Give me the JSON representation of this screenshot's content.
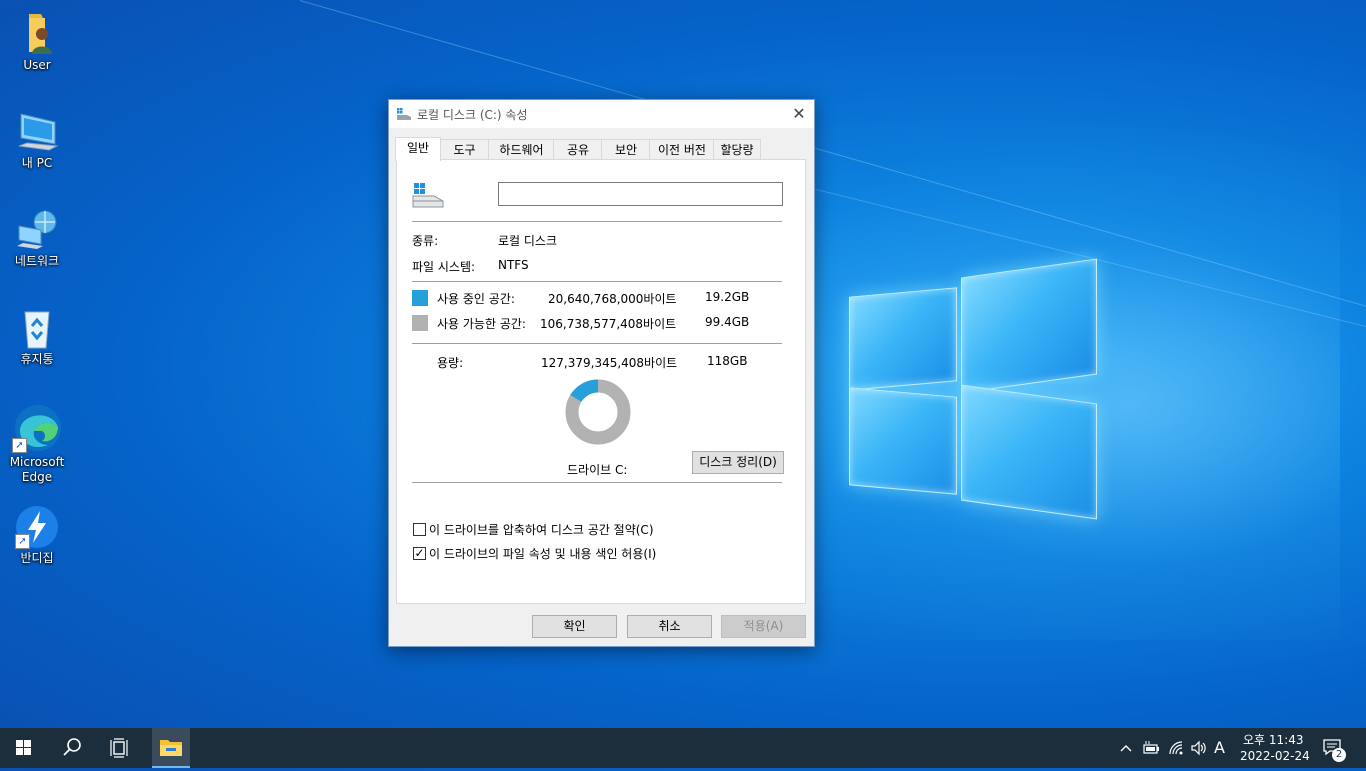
{
  "desktop": {
    "icons": [
      {
        "label": "User"
      },
      {
        "label": "내 PC"
      },
      {
        "label": "네트워크"
      },
      {
        "label": "휴지통"
      },
      {
        "label_line1": "Microsoft",
        "label_line2": "Edge"
      },
      {
        "label": "반디집"
      }
    ]
  },
  "dialog": {
    "title": "로컬 디스크 (C:) 속성",
    "tabs": [
      "일반",
      "도구",
      "하드웨어",
      "공유",
      "보안",
      "이전 버전",
      "할당량"
    ],
    "active_tab": "일반",
    "name_value": "",
    "type_label": "종류:",
    "type_value": "로컬 디스크",
    "fs_label": "파일 시스템:",
    "fs_value": "NTFS",
    "used": {
      "label": "사용 중인 공간:",
      "bytes": "20,640,768,000바이트",
      "size": "19.2GB",
      "color": "#26a0da",
      "fraction": 0.162
    },
    "free": {
      "label": "사용 가능한 공간:",
      "bytes": "106,738,577,408바이트",
      "size": "99.4GB",
      "color": "#b2b2b2"
    },
    "capacity": {
      "label": "용량:",
      "bytes": "127,379,345,408바이트",
      "size": "118GB"
    },
    "drive_label": "드라이브 C:",
    "cleanup_button": "디스크 정리(D)",
    "compress_checkbox": {
      "label": "이 드라이브를 압축하여 디스크 공간 절약(C)",
      "checked": false
    },
    "index_checkbox": {
      "label": "이 드라이브의 파일 속성 및 내용 색인 허용(I)",
      "checked": true,
      "mark": "✓"
    },
    "ok_button": "확인",
    "cancel_button": "취소",
    "apply_button": "적용(A)"
  },
  "taskbar": {
    "ime_indicator": "A",
    "time": "오후 11:43",
    "date": "2022-02-24",
    "notification_count": "2"
  },
  "colors": {
    "accent": "#0078d7",
    "taskbar": "#1c2e3c"
  }
}
